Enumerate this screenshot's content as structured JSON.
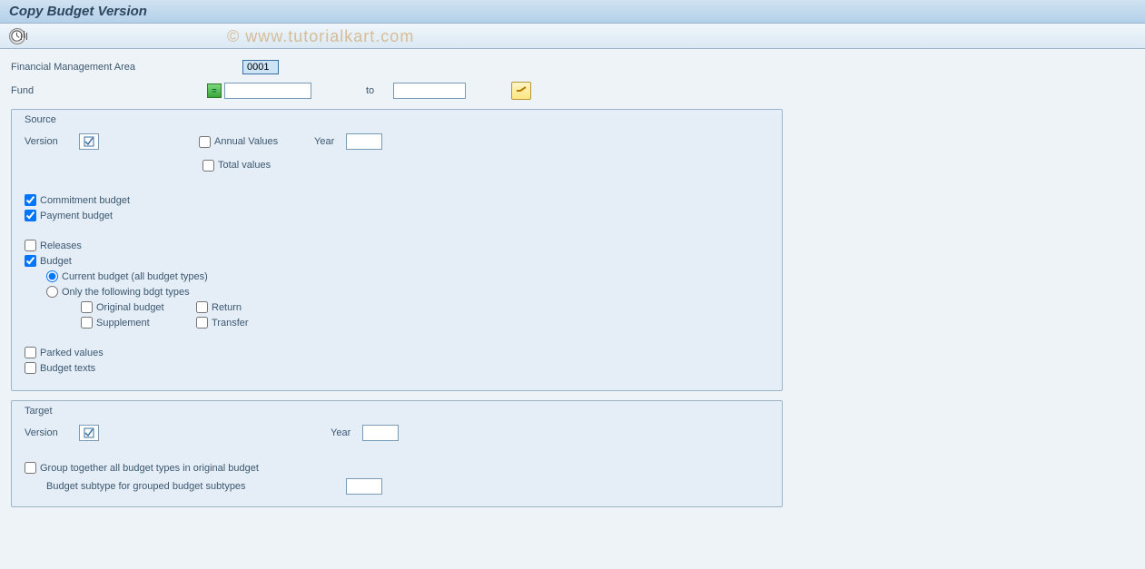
{
  "title": "Copy Budget Version",
  "watermark": "© www.tutorialkart.com",
  "header": {
    "fm_area_label": "Financial Management Area",
    "fm_area_value": "0001",
    "fund_label": "Fund",
    "fund_from": "",
    "to_label": "to",
    "fund_to": ""
  },
  "source": {
    "title": "Source",
    "version_label": "Version",
    "version_value": "",
    "annual_values_label": "Annual Values",
    "annual_values_checked": false,
    "year_label": "Year",
    "year_value": "",
    "total_values_label": "Total values",
    "total_values_checked": false,
    "commitment_label": "Commitment budget",
    "commitment_checked": true,
    "payment_label": "Payment budget",
    "payment_checked": true,
    "releases_label": "Releases",
    "releases_checked": false,
    "budget_label": "Budget",
    "budget_checked": true,
    "current_budget_label": "Current budget (all budget types)",
    "current_budget_selected": true,
    "only_following_label": "Only the following bdgt types",
    "only_following_selected": false,
    "original_budget_label": "Original budget",
    "return_label": "Return",
    "supplement_label": "Supplement",
    "transfer_label": "Transfer",
    "parked_label": "Parked values",
    "parked_checked": false,
    "budget_texts_label": "Budget texts",
    "budget_texts_checked": false
  },
  "target": {
    "title": "Target",
    "version_label": "Version",
    "version_value": "",
    "year_label": "Year",
    "year_value": "",
    "group_label": "Group together all budget types in original budget",
    "group_checked": false,
    "subtype_label": "Budget subtype for grouped budget subtypes",
    "subtype_value": ""
  }
}
